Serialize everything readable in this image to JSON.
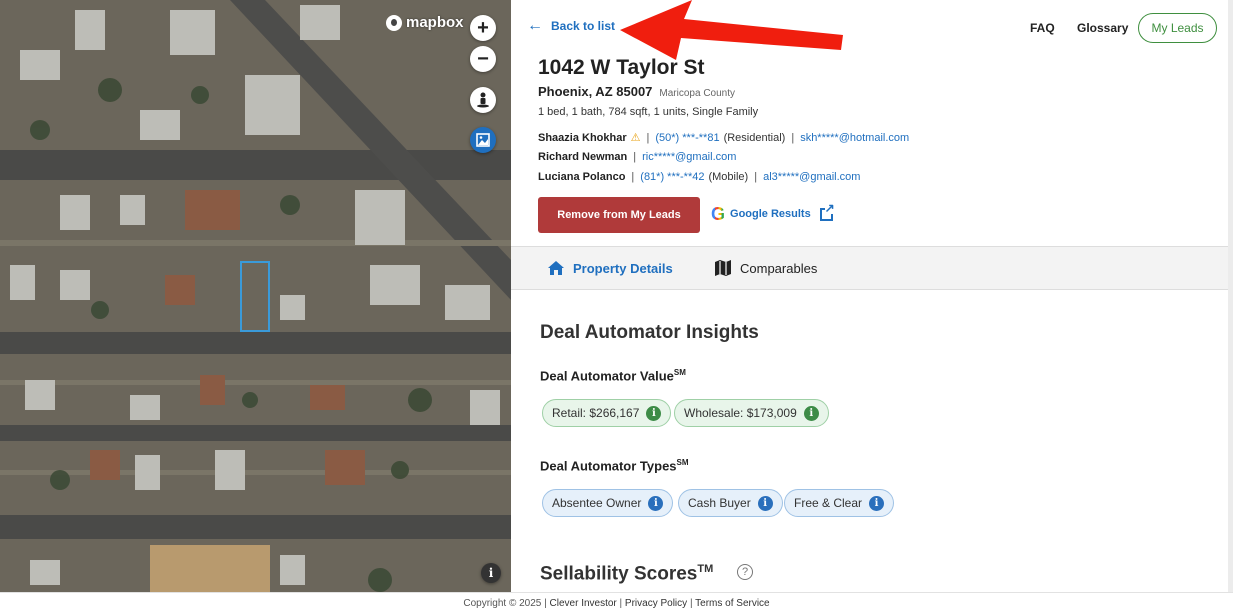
{
  "map": {
    "logo_text": "mapbox",
    "zoom_in": "+",
    "zoom_out": "−",
    "info": "i",
    "icons": [
      "zoom-in-icon",
      "zoom-out-icon",
      "street-view-icon",
      "satellite-layer-icon",
      "info-icon"
    ]
  },
  "header": {
    "back_label": "Back to list",
    "faq": "FAQ",
    "glossary": "Glossary",
    "my_leads": "My Leads"
  },
  "property": {
    "address": "1042 W Taylor St",
    "city_state_zip": "Phoenix, AZ 85007",
    "county": "Maricopa County",
    "specs": "1 bed, 1 bath, 784 sqft, 1 units, Single Family"
  },
  "contacts": [
    {
      "name": "Shaazia Khokhar",
      "warning": true,
      "phone": "(50*) ***-**81",
      "phone_type": "(Residential)",
      "email": "skh*****@hotmail.com"
    },
    {
      "name": "Richard Newman",
      "email": "ric*****@gmail.com"
    },
    {
      "name": "Luciana Polanco",
      "phone": "(81*) ***-**42",
      "phone_type": "(Mobile)",
      "email": "al3*****@gmail.com"
    }
  ],
  "actions": {
    "remove": "Remove from My Leads",
    "google": "Google Results"
  },
  "tabs": [
    {
      "label": "Property Details",
      "active": true
    },
    {
      "label": "Comparables",
      "active": false
    }
  ],
  "insights": {
    "title": "Deal Automator Insights",
    "value_title": "Deal Automator Value",
    "value_sup": "SM",
    "values": [
      {
        "label": "Retail: $266,167"
      },
      {
        "label": "Wholesale: $173,009"
      }
    ],
    "types_title": "Deal Automator Types",
    "types_sup": "SM",
    "types": [
      {
        "label": "Absentee Owner"
      },
      {
        "label": "Cash Buyer"
      },
      {
        "label": "Free & Clear"
      }
    ],
    "sellability_title": "Sellability Scores",
    "sellability_sup": "TM"
  },
  "footer": {
    "copyright": "Copyright © 2025 |",
    "links": [
      "Clever Investor",
      "Privacy Policy",
      "Terms of Service"
    ]
  },
  "colors": {
    "link_blue": "#1f6fbf",
    "remove_red": "#b03a3a",
    "leads_green": "#3f8f3f",
    "annotation_red": "#f01e0e"
  }
}
